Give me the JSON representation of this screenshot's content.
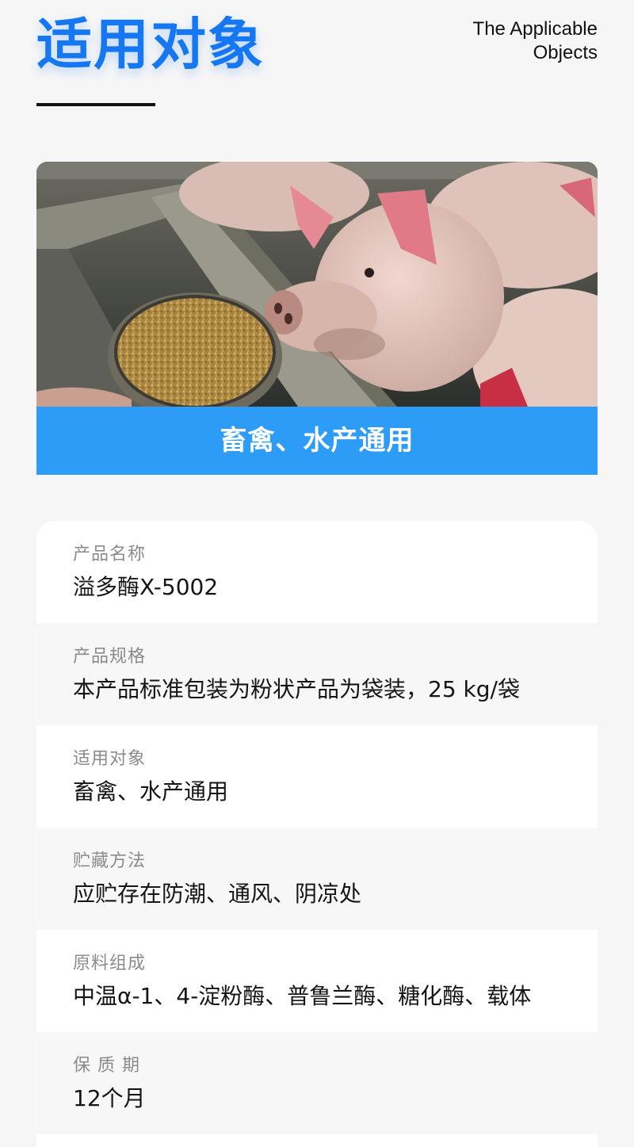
{
  "header": {
    "title": "适用对象",
    "subtitle_line1": "The Applicable",
    "subtitle_line2": "Objects"
  },
  "hero": {
    "image_subject": "pigs-eating-feed-pellets",
    "caption": "畜禽、水产通用"
  },
  "info": [
    {
      "label": "产品名称",
      "value": "溢多酶X-5002"
    },
    {
      "label": "产品规格",
      "value": "本产品标准包装为粉状产品为袋装，25 kg/袋"
    },
    {
      "label": "适用对象",
      "value": "畜禽、水产通用"
    },
    {
      "label": "贮藏方法",
      "value": "应贮存在防潮、通风、阴凉处"
    },
    {
      "label": "原料组成",
      "value": "中温α-1、4-淀粉酶、普鲁兰酶、糖化酶、载体"
    },
    {
      "label": "保 质 期",
      "value": "12个月"
    }
  ],
  "colors": {
    "accent": "#1677f2",
    "caption_bg": "#2d9cf7",
    "page_bg": "#f6f6f7"
  }
}
